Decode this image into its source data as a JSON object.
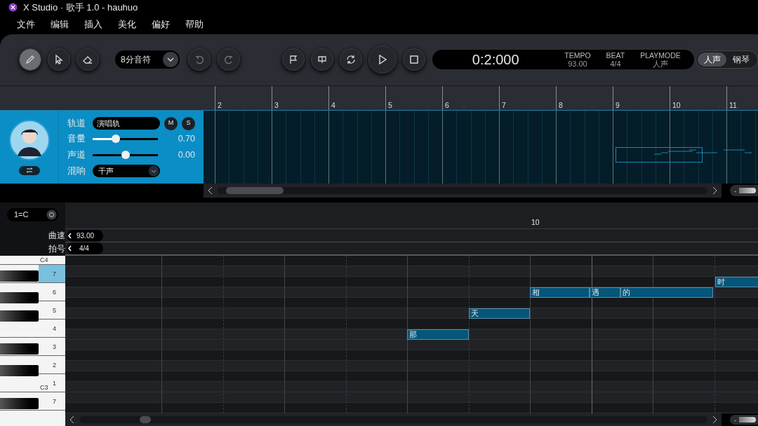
{
  "window": {
    "title": "X Studio · 歌手 1.0 - hauhuo"
  },
  "menu": [
    "文件",
    "编辑",
    "插入",
    "美化",
    "偏好",
    "帮助"
  ],
  "toolbar": {
    "tools": [
      {
        "kind": "pencil",
        "selected": true
      },
      {
        "kind": "pointer",
        "selected": false
      },
      {
        "kind": "eraser",
        "selected": false
      }
    ],
    "note_length": "8分音符",
    "time": "0:2:000",
    "readouts": [
      {
        "label": "TEMPO",
        "value": "93.00"
      },
      {
        "label": "BEAT",
        "value": "4/4"
      },
      {
        "label": "PLAYMODE",
        "value": "人声"
      }
    ],
    "mode_toggle": [
      {
        "label": "人声",
        "selected": true
      },
      {
        "label": "钢琴",
        "selected": false
      }
    ]
  },
  "ruler": {
    "bars": [
      "2",
      "3",
      "4",
      "5",
      "6",
      "7",
      "8",
      "9",
      "10",
      "11"
    ]
  },
  "track": {
    "name_label": "轨道",
    "name": "演唱轨",
    "mute": "M",
    "solo": "S",
    "volume_label": "音量",
    "volume": {
      "level": 0.35,
      "reading": "0.70"
    },
    "pan_label": "声道",
    "pan": {
      "level": 0.5,
      "reading": "0.00"
    },
    "reverb_label": "混响",
    "reverb": "干声",
    "zoom": {
      "minus": "-",
      "level": 0.6
    }
  },
  "piano_roll": {
    "key": "1=C",
    "tempo_label": "曲速",
    "tempo": "93.00",
    "beat_label": "拍号",
    "beat": "4/4",
    "bar": "10",
    "keys": [
      {
        "label": "C4",
        "selected": false
      },
      {
        "degree": "7",
        "selected": true
      },
      {
        "degree": "6",
        "selected": false
      },
      {
        "degree": "5",
        "selected": false
      },
      {
        "degree": "4",
        "selected": false
      },
      {
        "degree": "3",
        "selected": false
      },
      {
        "degree": "2",
        "selected": false
      },
      {
        "label": "C3",
        "degree": "1",
        "selected": false
      },
      {
        "degree": "7",
        "selected": false
      }
    ],
    "notes": [
      {
        "lyric": "那"
      },
      {
        "lyric": "天"
      },
      {
        "lyric": "相"
      },
      {
        "lyric": "遇"
      },
      {
        "lyric": "的"
      },
      {
        "lyric": "时"
      }
    ],
    "zoom": {
      "minus": "-",
      "level": 0.6
    }
  }
}
